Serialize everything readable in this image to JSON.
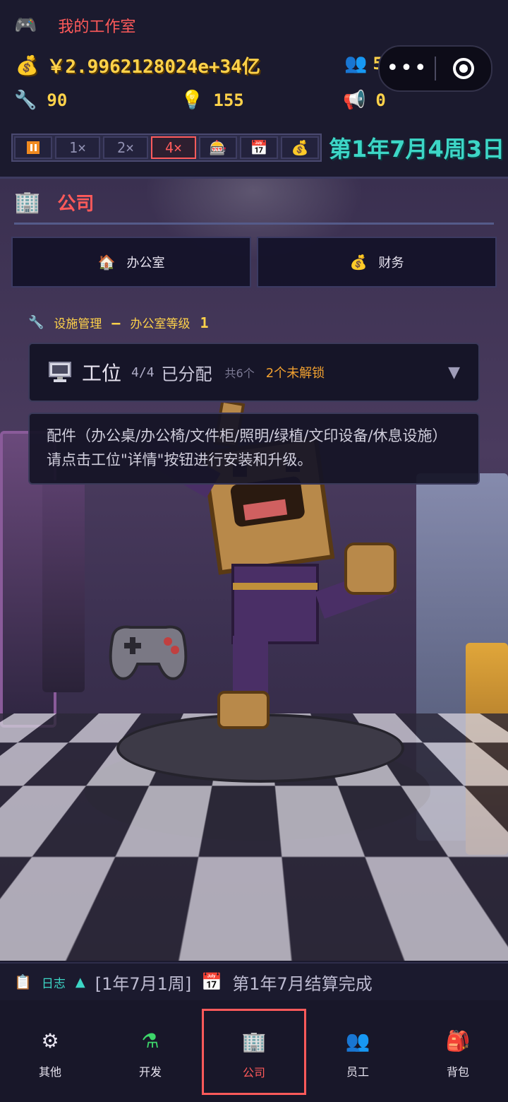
{
  "header": {
    "studio_icon": "gamepad-icon",
    "studio_name": "我的工作室",
    "money_icon": "money-bag-icon",
    "money_value": "￥2.9962128024e+34亿",
    "people_icon": "people-icon",
    "people_value": "50",
    "resources": [
      {
        "icon": "wrench-icon",
        "glyph": "🔧",
        "value": "90"
      },
      {
        "icon": "lightbulb-icon",
        "glyph": "💡",
        "value": "155"
      },
      {
        "icon": "megaphone-icon",
        "glyph": "📢",
        "value": "0"
      }
    ],
    "capsule": {
      "more_label": "•••"
    },
    "speed_buttons": [
      {
        "name": "pause",
        "label": ""
      },
      {
        "name": "speed-1x",
        "label": "1×"
      },
      {
        "name": "speed-2x",
        "label": "2×"
      },
      {
        "name": "speed-4x",
        "label": "4×",
        "active": true
      },
      {
        "name": "slot",
        "label": "🎰"
      },
      {
        "name": "calendar",
        "label": "📅"
      },
      {
        "name": "finance",
        "label": "💰"
      }
    ],
    "date_text": "第1年7月4周3日"
  },
  "company": {
    "title": "公司",
    "title_icon": "building-icon",
    "tabs": [
      {
        "icon": "house-icon",
        "glyph": "🏠",
        "label": "办公室"
      },
      {
        "icon": "money-bag-icon",
        "glyph": "💰",
        "label": "财务"
      }
    ],
    "facility": {
      "label": "设施管理",
      "dash": "–",
      "level_label": "办公室等级",
      "level_value": "1"
    },
    "workstation": {
      "name": "工位",
      "count": "4/4",
      "assigned": "已分配",
      "total": "共6个",
      "locked_num": "2",
      "locked_text": "个未解锁",
      "arrow": "▼"
    },
    "hint": "配件（办公桌/办公椅/文件柜/照明/绿植/文印设备/休息设施）请点击工位\"详情\"按钮进行安装和升级。"
  },
  "log": {
    "label": "日志",
    "week": "[1年7月1周]",
    "message": "第1年7月结算完成"
  },
  "nav": [
    {
      "icon": "gear-icon",
      "glyph": "⚙",
      "label": "其他",
      "active": false
    },
    {
      "icon": "flask-icon",
      "glyph": "⚗",
      "label": "开发",
      "active": false
    },
    {
      "icon": "office-building-icon",
      "glyph": "🏢",
      "label": "公司",
      "active": true
    },
    {
      "icon": "staff-icon",
      "glyph": "👥",
      "label": "员工",
      "active": false
    },
    {
      "icon": "backpack-icon",
      "glyph": "🎒",
      "label": "背包",
      "active": false
    }
  ],
  "colors": {
    "accent_red": "#ff5a5a",
    "gold": "#ffd24a",
    "teal": "#3dd6c6",
    "orange": "#f0a030",
    "bg": "#1b1a2e"
  }
}
